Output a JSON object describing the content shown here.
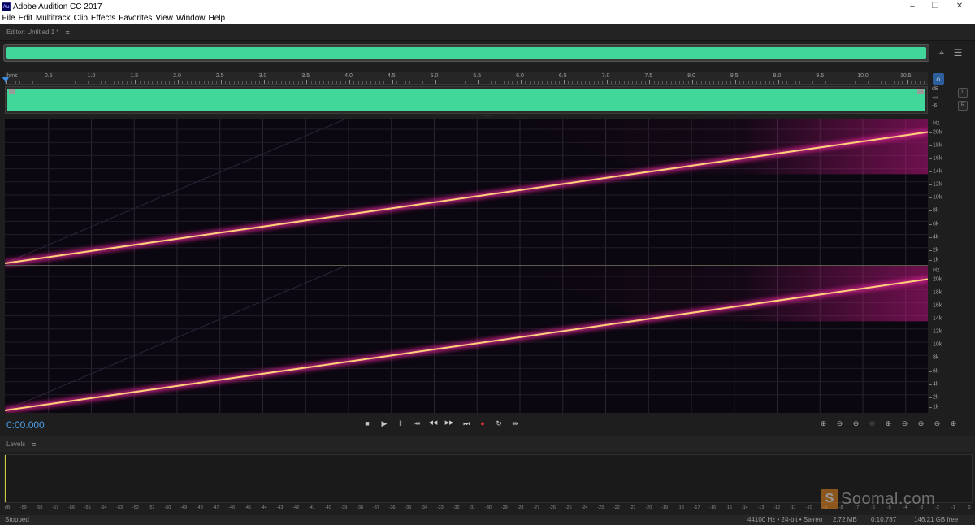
{
  "window": {
    "title": "Adobe Audition CC 2017",
    "logo_text": "Au",
    "minimize": "–",
    "maximize": "❐",
    "close": "✕"
  },
  "menu": [
    "File",
    "Edit",
    "Multitrack",
    "Clip",
    "Effects",
    "Favorites",
    "View",
    "Window",
    "Help"
  ],
  "editor_panel": {
    "title": "Editor: Untitled 1 *",
    "menu_icon": "≡"
  },
  "ruler": {
    "unit": "hms",
    "labels": [
      "0.5",
      "1.0",
      "1.5",
      "2.0",
      "2.5",
      "3.0",
      "3.5",
      "4.0",
      "4.5",
      "5.0",
      "5.5",
      "6.0",
      "6.5",
      "7.0",
      "7.5",
      "8.0",
      "8.5",
      "9.0",
      "9.5",
      "10.0",
      "10.5"
    ]
  },
  "db_scale": {
    "unit": "dB",
    "labels": [
      "-∞",
      "-6"
    ],
    "channel_left": "L",
    "channel_right": "R"
  },
  "spectrogram": {
    "hz_unit": "Hz",
    "freq_labels": [
      "20k",
      "18k",
      "16k",
      "14k",
      "12k",
      "10k",
      "8k",
      "6k",
      "4k",
      "2k",
      "1k"
    ],
    "sweep_start_hz": 0,
    "sweep_end_hz": 20000,
    "duration_s": 10.787,
    "line_color": "#ffd27a",
    "glow_color": "#d0208c"
  },
  "transport": {
    "time": "0:00.000",
    "buttons": {
      "stop": "■",
      "play": "▶",
      "pause": "‖",
      "to_start": "⏮",
      "rewind": "◀◀",
      "forward": "▶▶",
      "to_end": "⏭",
      "record": "●",
      "loop": "↻",
      "skip": "⇹"
    },
    "record_color": "#e03232",
    "zoom_icons": [
      "⊕",
      "⊖",
      "⊕",
      "⊖",
      "⊕",
      "⊖",
      "⊕",
      "⊖",
      "⊕"
    ]
  },
  "levels_panel": {
    "title": "Levels",
    "menu_icon": "≡",
    "scale": [
      "dB",
      "-59",
      "-58",
      "-57",
      "-56",
      "-55",
      "-54",
      "-53",
      "-52",
      "-51",
      "-50",
      "-49",
      "-48",
      "-47",
      "-46",
      "-45",
      "-44",
      "-43",
      "-42",
      "-41",
      "-40",
      "-39",
      "-38",
      "-37",
      "-36",
      "-35",
      "-34",
      "-33",
      "-32",
      "-31",
      "-30",
      "-29",
      "-28",
      "-27",
      "-26",
      "-25",
      "-24",
      "-23",
      "-22",
      "-21",
      "-20",
      "-19",
      "-18",
      "-17",
      "-16",
      "-15",
      "-14",
      "-13",
      "-12",
      "-11",
      "-10",
      "-9",
      "-8",
      "-7",
      "-6",
      "-5",
      "-4",
      "-3",
      "-2",
      "-1",
      "0"
    ]
  },
  "status": {
    "state": "Stopped",
    "format": "44100 Hz • 24-bit • Stereo",
    "size": "2.72 MB",
    "duration": "0:10.787",
    "free": "146.21 GB free"
  },
  "watermark": {
    "logo": "S",
    "text": "Soomal.com"
  },
  "colors": {
    "waveform": "#41d69a",
    "accent": "#4a9fe8",
    "background": "#1e1e1e"
  }
}
